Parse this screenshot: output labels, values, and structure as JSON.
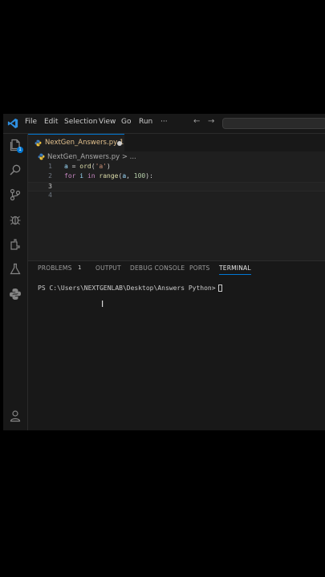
{
  "menu": [
    "File",
    "Edit",
    "Selection",
    "View",
    "Go",
    "Run",
    "···"
  ],
  "nav": {
    "back": "←",
    "forward": "→"
  },
  "activity": {
    "explorer_badge": "1"
  },
  "tab": {
    "label": "NextGen_Answers.py 1"
  },
  "breadcrumb": {
    "text": "NextGen_Answers.py > ..."
  },
  "editor": {
    "lines": [
      {
        "number": "1",
        "code": "a = ord('a')"
      },
      {
        "number": "2",
        "code": "for i in range(a, 100):"
      },
      {
        "number": "3",
        "code": ""
      },
      {
        "number": "4",
        "code": ""
      }
    ]
  },
  "panel": {
    "tabs": [
      "PROBLEMS",
      "OUTPUT",
      "DEBUG CONSOLE",
      "PORTS",
      "TERMINAL"
    ],
    "problems_count": "1",
    "active_tab": "TERMINAL",
    "prompt": "PS C:\\Users\\NEXTGENLAB\\Desktop\\Answers Python>"
  },
  "colors": {
    "accent": "#0078d4",
    "modified_tab": "#e2c08d"
  }
}
